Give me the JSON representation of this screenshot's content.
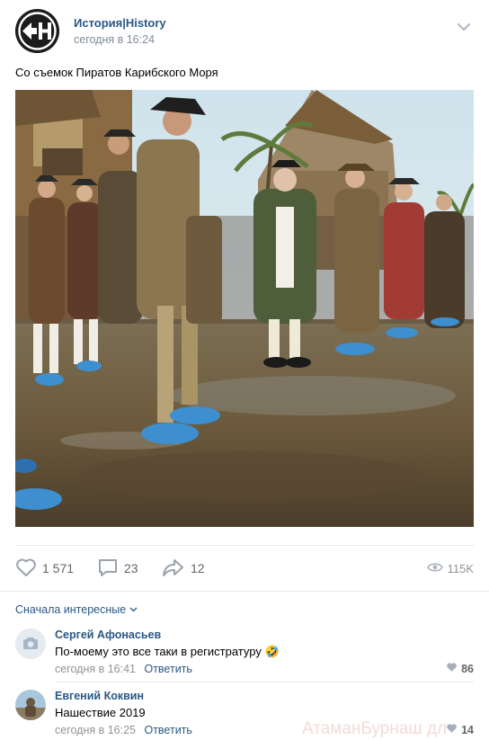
{
  "post": {
    "author": "История|History",
    "time": "сегодня в 16:24",
    "text": "Со съемок Пиратов Карибского Моря",
    "logo_icon": "eh-logo-icon",
    "more_icon": "chevron-down-icon"
  },
  "actions": {
    "likes": "1 571",
    "comments": "23",
    "shares": "12",
    "views": "115K"
  },
  "comments_section": {
    "sort_label": "Сначала интересные"
  },
  "comments": [
    {
      "name": "Сергей Афонасьев",
      "text": "По-моему это все таки в регистратуру",
      "emoji": "🤣",
      "time": "сегодня в 16:41",
      "reply": "Ответить",
      "likes": "86"
    },
    {
      "name": "Евгений Коквин",
      "text": "Нашествие 2019",
      "time": "сегодня в 16:25",
      "reply": "Ответить",
      "likes": "14"
    }
  ],
  "watermark": "АтаманБурнаш дл",
  "colors": {
    "link": "#2a5885",
    "secondary": "#818c99",
    "icon": "#99a2ad"
  }
}
